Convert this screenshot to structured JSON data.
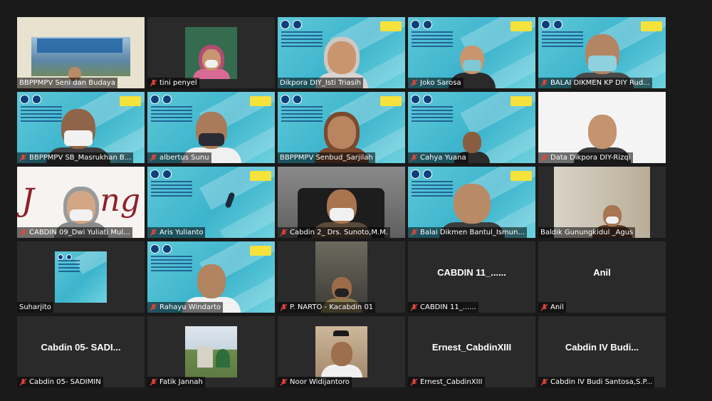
{
  "participants": [
    {
      "name": "BBPPMPV Seni dan Budaya",
      "muted": false,
      "display": "video"
    },
    {
      "name": "tini penyel",
      "muted": true,
      "display": "video"
    },
    {
      "name": "Dikpora DIY_Isti Triasih",
      "muted": false,
      "display": "video"
    },
    {
      "name": "Joko Sarosa",
      "muted": true,
      "display": "video"
    },
    {
      "name": "BALAI DIKMEN KP DIY Rud...",
      "muted": true,
      "display": "video"
    },
    {
      "name": "BBPPMPV SB_Masrukhan B...",
      "muted": true,
      "display": "video"
    },
    {
      "name": "albertus Sunu",
      "muted": true,
      "display": "video"
    },
    {
      "name": "BBPPMPV Senbud_Sarjilah",
      "muted": false,
      "display": "video",
      "active": true
    },
    {
      "name": "Cahya Yuana",
      "muted": true,
      "display": "video"
    },
    {
      "name": "Data Dikpora DIY-Rizqi",
      "muted": true,
      "display": "video"
    },
    {
      "name": "CABDIN 09_Dwi Yuliati Mul...",
      "muted": true,
      "display": "video"
    },
    {
      "name": "Aris Yulianto",
      "muted": true,
      "display": "video"
    },
    {
      "name": "Cabdin 2_ Drs. Sunoto,M.M.",
      "muted": true,
      "display": "video"
    },
    {
      "name": "Balai Dikmen Bantul_Ismun...",
      "muted": true,
      "display": "video"
    },
    {
      "name": "Baldik Gunungkidul _Agus",
      "muted": false,
      "display": "video"
    },
    {
      "name": "Suharjito",
      "muted": false,
      "display": "video"
    },
    {
      "name": "Rahayu Windarto",
      "muted": true,
      "display": "video"
    },
    {
      "name": "P. NARTO - Kacabdin 01",
      "muted": true,
      "display": "video"
    },
    {
      "name": "CABDIN 11_......",
      "muted": true,
      "display": "name",
      "big": "CABDIN 11_......"
    },
    {
      "name": "Anil",
      "muted": true,
      "display": "name",
      "big": "Anil"
    },
    {
      "name": "Cabdin 05- SADIMIN",
      "muted": true,
      "display": "name",
      "big": "Cabdin 05- SADI..."
    },
    {
      "name": "Fatik Jannah",
      "muted": true,
      "display": "video"
    },
    {
      "name": "Noor Widijantoro",
      "muted": true,
      "display": "video"
    },
    {
      "name": "Ernest_CabdinXIII",
      "muted": true,
      "display": "name",
      "big": "Ernest_CabdinXIII"
    },
    {
      "name": "Cabdin IV Budi Santosa,S.P...",
      "muted": true,
      "display": "name",
      "big": "Cabdin IV Budi..."
    }
  ],
  "colors": {
    "background": "#1a1a1a",
    "tile": "#2a2a2a",
    "active_border": "#c9d64a",
    "muted_icon": "#e0463c",
    "slide": "#4fbfd4"
  }
}
